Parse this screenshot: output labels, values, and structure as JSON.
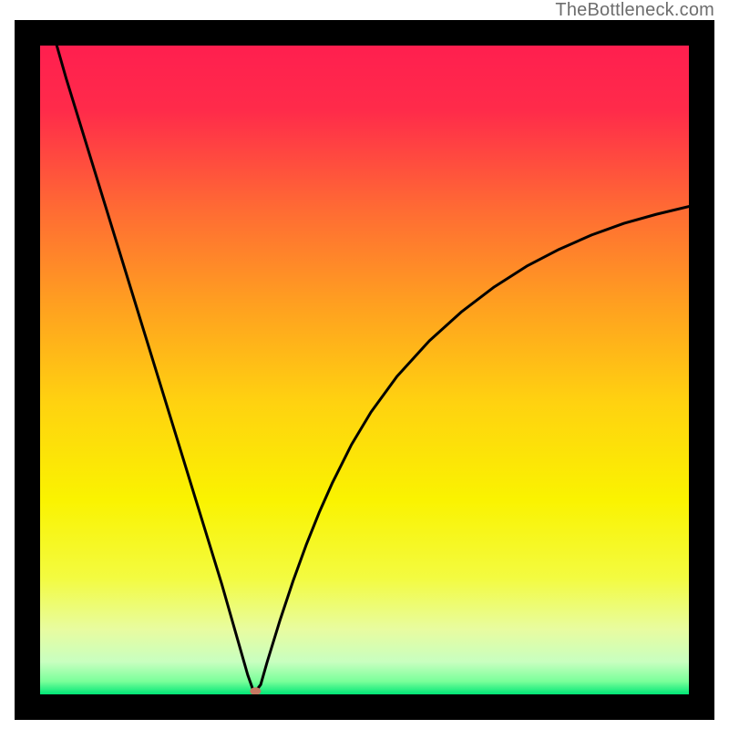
{
  "watermark": "TheBottleneck.com",
  "chart_data": {
    "type": "line",
    "title": "",
    "xlabel": "",
    "ylabel": "",
    "xlim": [
      0,
      100
    ],
    "ylim": [
      0,
      100
    ],
    "background_gradient": [
      {
        "offset": 0.0,
        "color": "#ff1f4f"
      },
      {
        "offset": 0.1,
        "color": "#ff2b4a"
      },
      {
        "offset": 0.25,
        "color": "#ff6a34"
      },
      {
        "offset": 0.4,
        "color": "#ffa020"
      },
      {
        "offset": 0.55,
        "color": "#ffd210"
      },
      {
        "offset": 0.7,
        "color": "#faf300"
      },
      {
        "offset": 0.82,
        "color": "#f3fb40"
      },
      {
        "offset": 0.9,
        "color": "#e8fca0"
      },
      {
        "offset": 0.95,
        "color": "#c8ffc0"
      },
      {
        "offset": 0.98,
        "color": "#7aff9a"
      },
      {
        "offset": 1.0,
        "color": "#00e676"
      }
    ],
    "series": [
      {
        "name": "bottleneck-curve",
        "color": "#000000",
        "stroke_width": 3,
        "x": [
          0.0,
          2,
          4,
          6,
          8,
          10,
          12,
          14,
          16,
          18,
          20,
          22,
          24,
          26,
          28,
          30,
          31,
          32,
          33,
          34,
          35,
          37,
          39,
          41,
          43,
          45,
          48,
          51,
          55,
          60,
          65,
          70,
          75,
          80,
          85,
          90,
          95,
          100
        ],
        "y": [
          109,
          102,
          95,
          88.5,
          82,
          75.5,
          69,
          62.5,
          56,
          49.5,
          43,
          36.5,
          30,
          23.5,
          17,
          10,
          6.5,
          3,
          0.2,
          1.5,
          5,
          11.5,
          17.5,
          23,
          28,
          32.5,
          38.5,
          43.5,
          49,
          54.5,
          59,
          62.8,
          66,
          68.6,
          70.8,
          72.6,
          74,
          75.2
        ]
      }
    ],
    "marker": {
      "x": 33.2,
      "y": 0.5,
      "rx": 6,
      "ry": 4.2,
      "color": "#c77862"
    }
  }
}
